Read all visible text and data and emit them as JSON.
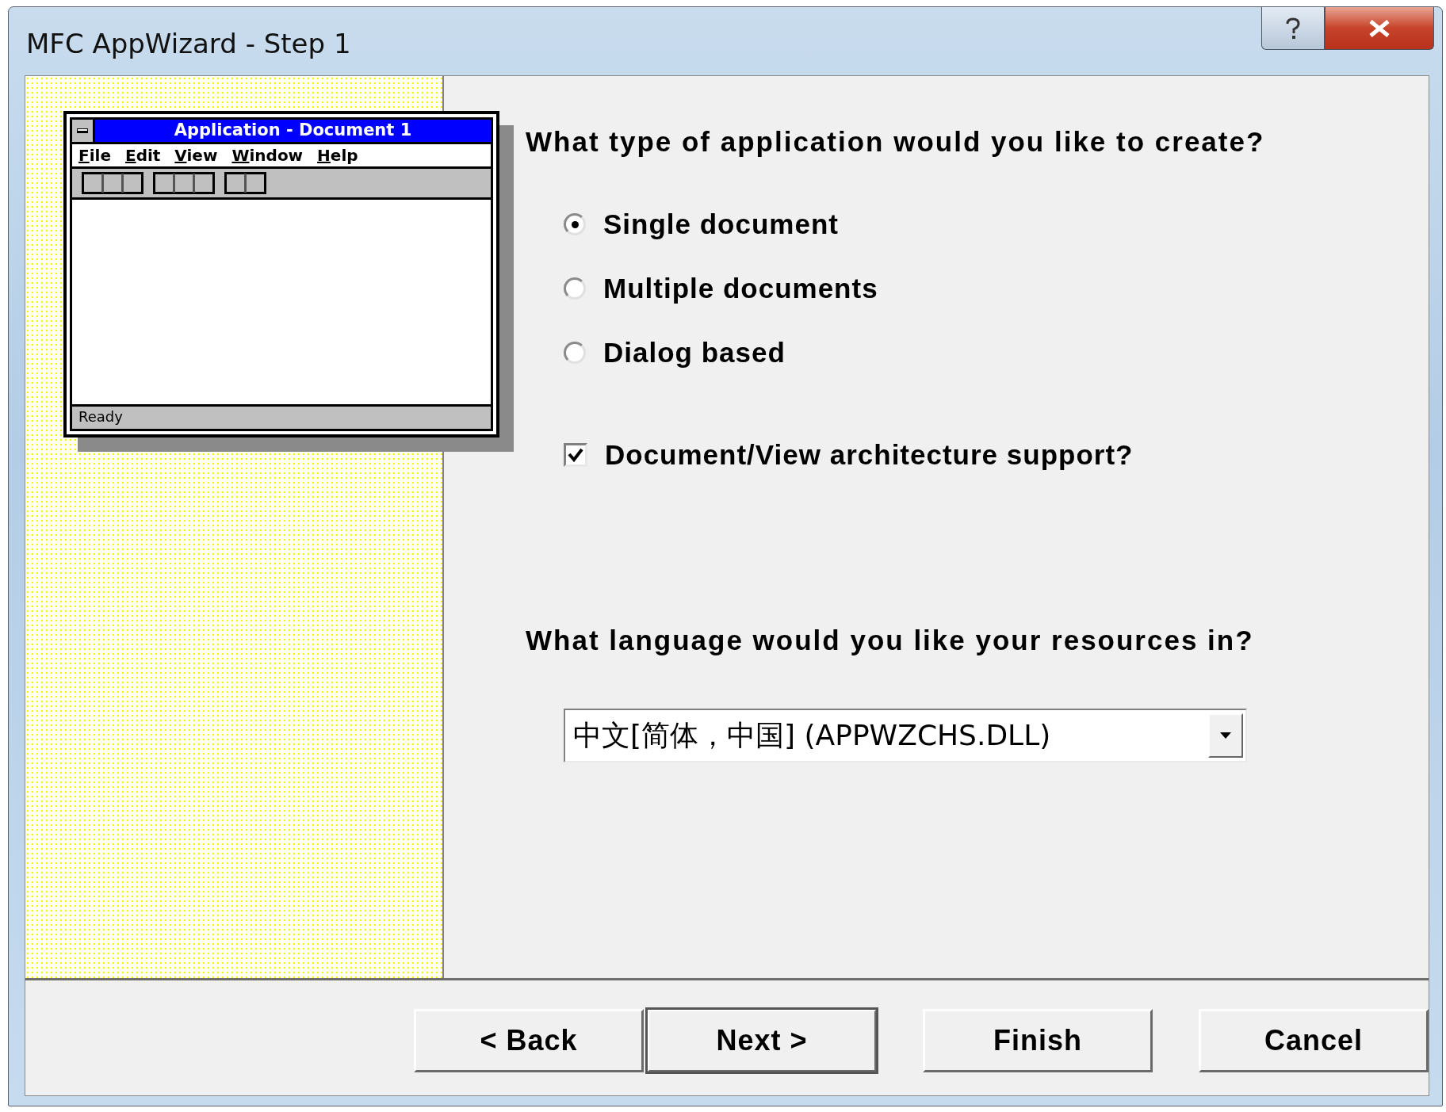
{
  "window": {
    "title": "MFC AppWizard - Step 1"
  },
  "preview": {
    "title": "Application - Document 1",
    "menu": [
      "File",
      "Edit",
      "View",
      "Window",
      "Help"
    ],
    "status": "Ready"
  },
  "question": "What type of application would you like to create?",
  "app_types": [
    {
      "label": "Single document",
      "selected": true
    },
    {
      "label": "Multiple documents",
      "selected": false
    },
    {
      "label": "Dialog based",
      "selected": false
    }
  ],
  "docview": {
    "label": "Document/View architecture support?",
    "checked": true
  },
  "language_question": "What language would you like your resources in?",
  "language": {
    "value": "中文[简体，中国] (APPWZCHS.DLL)"
  },
  "buttons": [
    {
      "label": "< Back",
      "default": false
    },
    {
      "label": "Next >",
      "default": true
    },
    {
      "label": "Finish",
      "default": false
    },
    {
      "label": "Cancel",
      "default": false
    }
  ]
}
